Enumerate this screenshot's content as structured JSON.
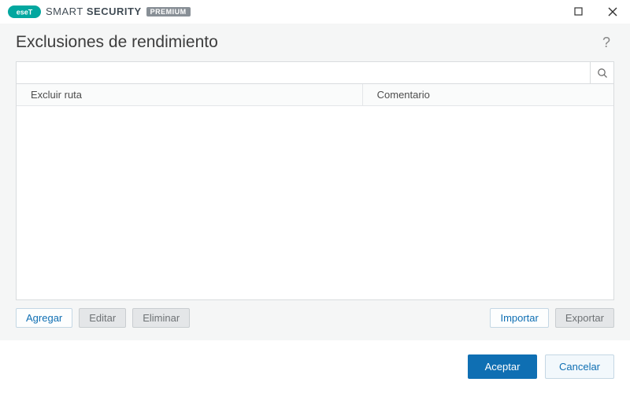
{
  "brand": {
    "name_thin": "SMART",
    "name_bold": "SECURITY",
    "badge": "PREMIUM"
  },
  "header": {
    "title": "Exclusiones de rendimiento"
  },
  "search": {
    "value": ""
  },
  "table": {
    "columns": {
      "path": "Excluir ruta",
      "comment": "Comentario"
    },
    "rows": []
  },
  "actions": {
    "add": "Agregar",
    "edit": "Editar",
    "delete": "Eliminar",
    "import": "Importar",
    "export": "Exportar"
  },
  "footer": {
    "accept": "Aceptar",
    "cancel": "Cancelar"
  }
}
